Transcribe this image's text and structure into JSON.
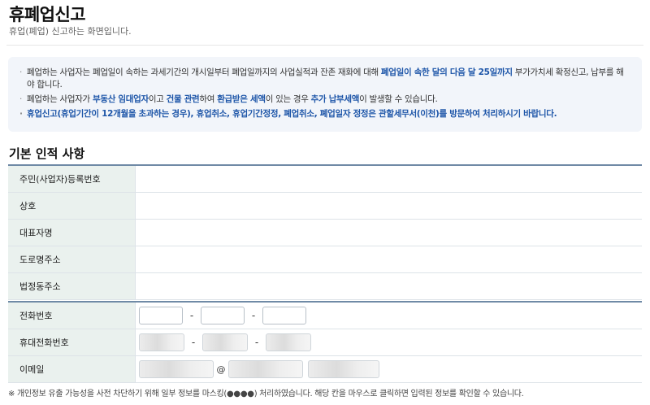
{
  "header": {
    "title": "휴폐업신고",
    "subtitle": "휴업(폐업) 신고하는 화면입니다."
  },
  "notice": {
    "item1": {
      "prefix": "폐업하는 사업자는 폐업일이 속하는 과세기간의 개시일부터 폐업일까지의 사업실적과 잔존 재화에 대해 ",
      "highlight": "폐업일이 속한 달의 다음 달 25일까지",
      "suffix": " 부가가치세 확정신고, 납부를 해야 합니다."
    },
    "item2": {
      "p1": "폐업하는 사업자가 ",
      "h1": "부동산 임대업자",
      "p2": "이고 ",
      "h2": "건물 관련",
      "p3": "하여 ",
      "h3": "환급받은 세액",
      "p4": "이 있는 경우 ",
      "h4": "추가 납부세액",
      "p5": "이 발생할 수 있습니다."
    },
    "item3": "휴업신고(휴업기간이 12개월을 초과하는 경우), 휴업취소, 휴업기간정정, 폐업취소, 폐업일자 정정은 관할세무서(이천)를 방문하여 처리하시기 바랍니다."
  },
  "section": {
    "title": "기본 인적 사항"
  },
  "fields": {
    "reg_number": "주민(사업자)등록번호",
    "trade_name": "상호",
    "representative": "대표자명",
    "road_address": "도로명주소",
    "lot_address": "법정동주소",
    "phone": "전화번호",
    "mobile": "휴대전화번호",
    "email": "이메일"
  },
  "separators": {
    "dash": "-",
    "at": "@"
  },
  "footnote": "※ 개인정보 유출 가능성을 사전 차단하기 위해 일부 정보를 마스킹(●●●●) 처리하였습니다. 해당 칸을 마우스로 클릭하면 입력된 정보를 확인할 수 있습니다."
}
